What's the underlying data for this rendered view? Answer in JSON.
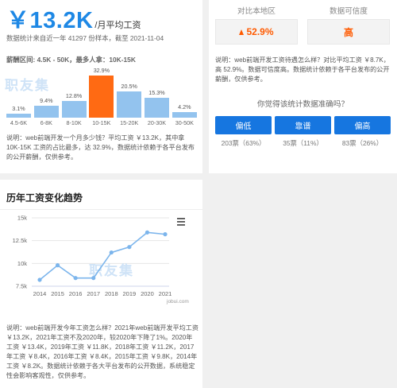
{
  "salary": {
    "amount": "￥13.2K",
    "unit": "/月平均工资",
    "meta": "数据统计来自近一年 41297 份样本，截至 2021-11-04",
    "range": "薪酬区间: 4.5K - 50K，最多人拿：10K-15K"
  },
  "distribution": {
    "watermark": "职友集",
    "bars": [
      {
        "label": "4.5-6K",
        "pct": "3.1%",
        "value": 3.1
      },
      {
        "label": "6-8K",
        "pct": "9.4%",
        "value": 9.4
      },
      {
        "label": "8-10K",
        "pct": "12.8%",
        "value": 12.8
      },
      {
        "label": "10-15K",
        "pct": "32.9%",
        "value": 32.9,
        "highlight": true
      },
      {
        "label": "15-20K",
        "pct": "20.5%",
        "value": 20.5
      },
      {
        "label": "20-30K",
        "pct": "15.3%",
        "value": 15.3
      },
      {
        "label": "30-50K",
        "pct": "4.2%",
        "value": 4.2
      }
    ],
    "note": "说明：web前端开发一个月多少钱？平均工资 ￥13.2K，其中拿 10K-15K 工资的占比最多，达 32.9%，数据统计依赖于各平台发布的公开薪酬，仅供参考。"
  },
  "compare": {
    "header_local": "对比本地区",
    "header_confidence": "数据可信度",
    "local_value": "52.9%",
    "confidence_value": "高",
    "note": "说明：web前端开发工资待遇怎么样？对比平均工资 ￥8.7K，高 52.9%。数据可信度高。数据统计依赖于各平台发布的公开薪酬，仅供参考。",
    "vote_question": "你觉得该统计数据准确吗？",
    "votes": [
      {
        "label": "偏低",
        "count": "203票（63%）"
      },
      {
        "label": "靠谱",
        "count": "35票（11%）"
      },
      {
        "label": "偏高",
        "count": "83票（26%）"
      }
    ]
  },
  "trend": {
    "title": "历年工资变化趋势",
    "watermark": "职友集",
    "source": "jobui.com",
    "note": "说明：web前端开发今年工资怎么样？2021年web前端开发平均工资 ￥13.2K，2021年工资不及2020年，较2020年下降了1%。2020年工资 ￥13.4K，2019年工资 ￥11.8K，2018年工资 ￥11.2K，2017年工资 ￥8.4K，2016年工资 ￥8.4K，2015年工资 ￥9.8K，2014年工资 ￥8.2K。数据统计依赖于各大平台发布的公开数据，系统稳定性会影响客观性，仅供参考。"
  },
  "chart_data": {
    "type": "line",
    "x": [
      "2014",
      "2015",
      "2016",
      "2017",
      "2018",
      "2019",
      "2020",
      "2021"
    ],
    "values": [
      8.2,
      9.8,
      8.4,
      8.4,
      11.2,
      11.8,
      13.4,
      13.2
    ],
    "y_ticks": [
      "7.5k",
      "10k",
      "12.5k",
      "15k"
    ],
    "ylim": [
      7.5,
      15
    ],
    "grid": true,
    "line_color": "#7cb5ec",
    "menu_icon": "hamburger-menu-icon"
  }
}
